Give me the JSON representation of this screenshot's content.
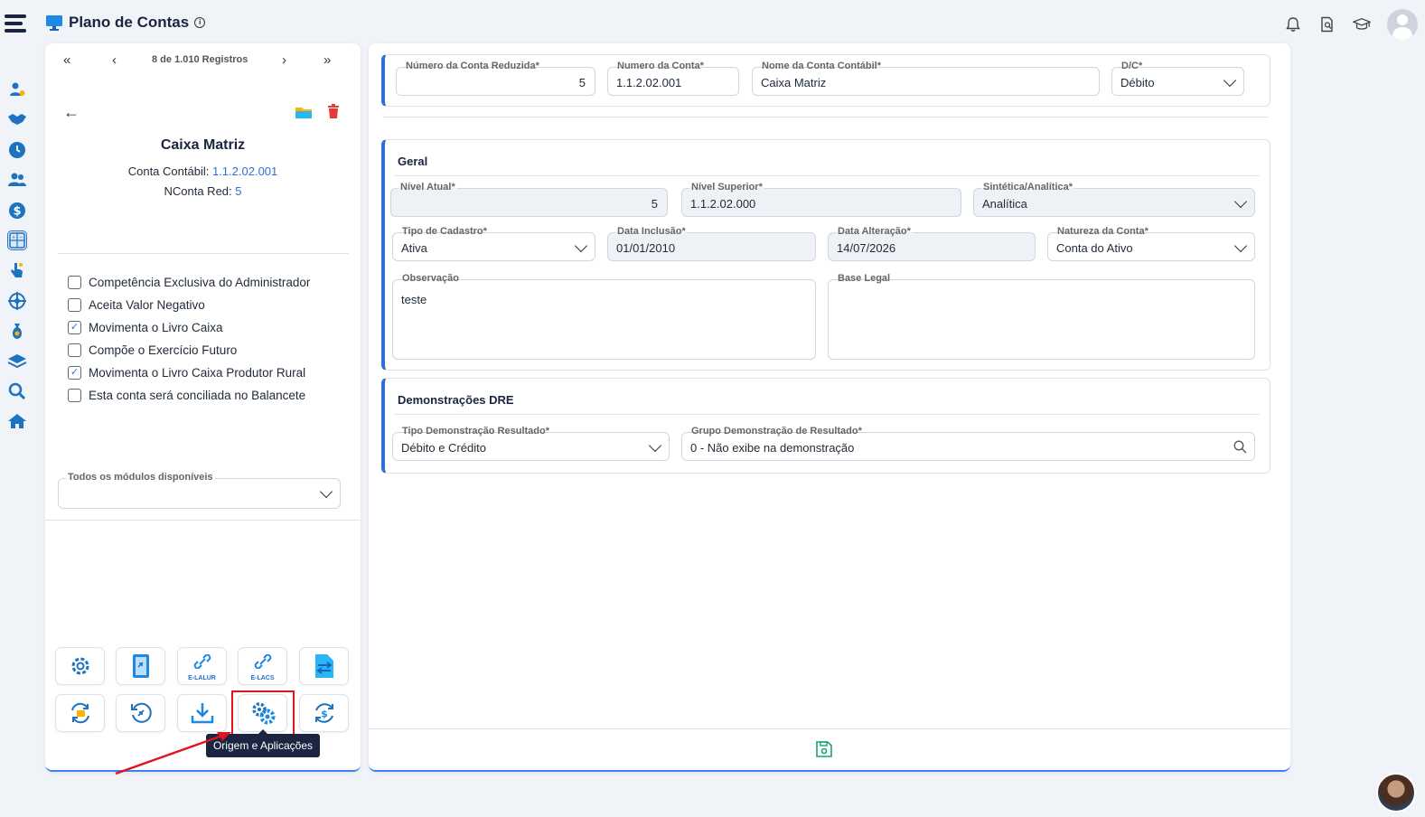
{
  "header": {
    "title": "Plano de Contas",
    "icons": [
      "bell-icon",
      "document-search-icon",
      "graduation-cap-icon",
      "user-avatar-icon"
    ]
  },
  "sidebar": {
    "icons": [
      "user-money-icon",
      "handshake-icon",
      "clock-icon",
      "users-icon",
      "dollar-icon",
      "calculator-icon",
      "hand-pointer-icon",
      "network-icon",
      "money-bag-icon",
      "layers-icon",
      "search-icon",
      "home-icon"
    ],
    "active_index": 5
  },
  "left": {
    "pager": {
      "first": "«",
      "prev": "‹",
      "records": "8 de 1.010 Registros",
      "next": "›",
      "last": "»"
    },
    "account_name": "Caixa Matriz",
    "conta_contabil_label": "Conta Contábil:",
    "conta_contabil_value": "1.1.2.02.001",
    "nconta_label": "NConta Red:",
    "nconta_value": "5",
    "checkboxes": [
      {
        "label": "Competência Exclusiva do Administrador",
        "checked": false
      },
      {
        "label": "Aceita Valor Negativo",
        "checked": false
      },
      {
        "label": "Movimenta o Livro Caixa",
        "checked": true
      },
      {
        "label": "Compõe o Exercício Futuro",
        "checked": false
      },
      {
        "label": "Movimenta o Livro Caixa Produtor Rural",
        "checked": true
      },
      {
        "label": "Esta conta será conciliada no Balancete",
        "checked": false
      }
    ],
    "modules_label": "Todos os módulos disponíveis",
    "modules_value": "",
    "tools": {
      "elalur_label": "E-LALUR",
      "elacs_label": "E-LACS"
    },
    "tooltip": "Origem e Aplicações"
  },
  "form": {
    "top": {
      "conta_reduzida_label": "Número da Conta Reduzida*",
      "conta_reduzida_value": "5",
      "numero_conta_label": "Numero da Conta*",
      "numero_conta_value": "1.1.2.02.001",
      "nome_conta_label": "Nome da Conta Contábil*",
      "nome_conta_value": "Caixa Matriz",
      "dc_label": "D/C*",
      "dc_value": "Débito"
    },
    "geral": {
      "title": "Geral",
      "nivel_atual_label": "Nível Atual*",
      "nivel_atual_value": "5",
      "nivel_superior_label": "Nível Superior*",
      "nivel_superior_value": "1.1.2.02.000",
      "sintetica_label": "Sintética/Analítica*",
      "sintetica_value": "Analítica",
      "tipo_cadastro_label": "Tipo de Cadastro*",
      "tipo_cadastro_value": "Ativa",
      "data_inclusao_label": "Data Inclusão*",
      "data_inclusao_value": "01/01/2010",
      "data_alteracao_label": "Data Alteração*",
      "data_alteracao_value": "14/07/2026",
      "natureza_label": "Natureza da Conta*",
      "natureza_value": "Conta do Ativo",
      "observacao_label": "Observação",
      "observacao_value": "teste",
      "base_legal_label": "Base Legal",
      "base_legal_value": ""
    },
    "dre": {
      "title": "Demonstrações DRE",
      "tipo_label": "Tipo Demonstração Resultado*",
      "tipo_value": "Débito e Crédito",
      "grupo_label": "Grupo Demonstração de Resultado*",
      "grupo_value": "0 - Não exibe na demonstração"
    }
  },
  "colors": {
    "accent": "#2f6fd6",
    "highlight": "#e0141e",
    "tooltip_bg": "#1b2440",
    "save_icon": "#1aa37a"
  }
}
